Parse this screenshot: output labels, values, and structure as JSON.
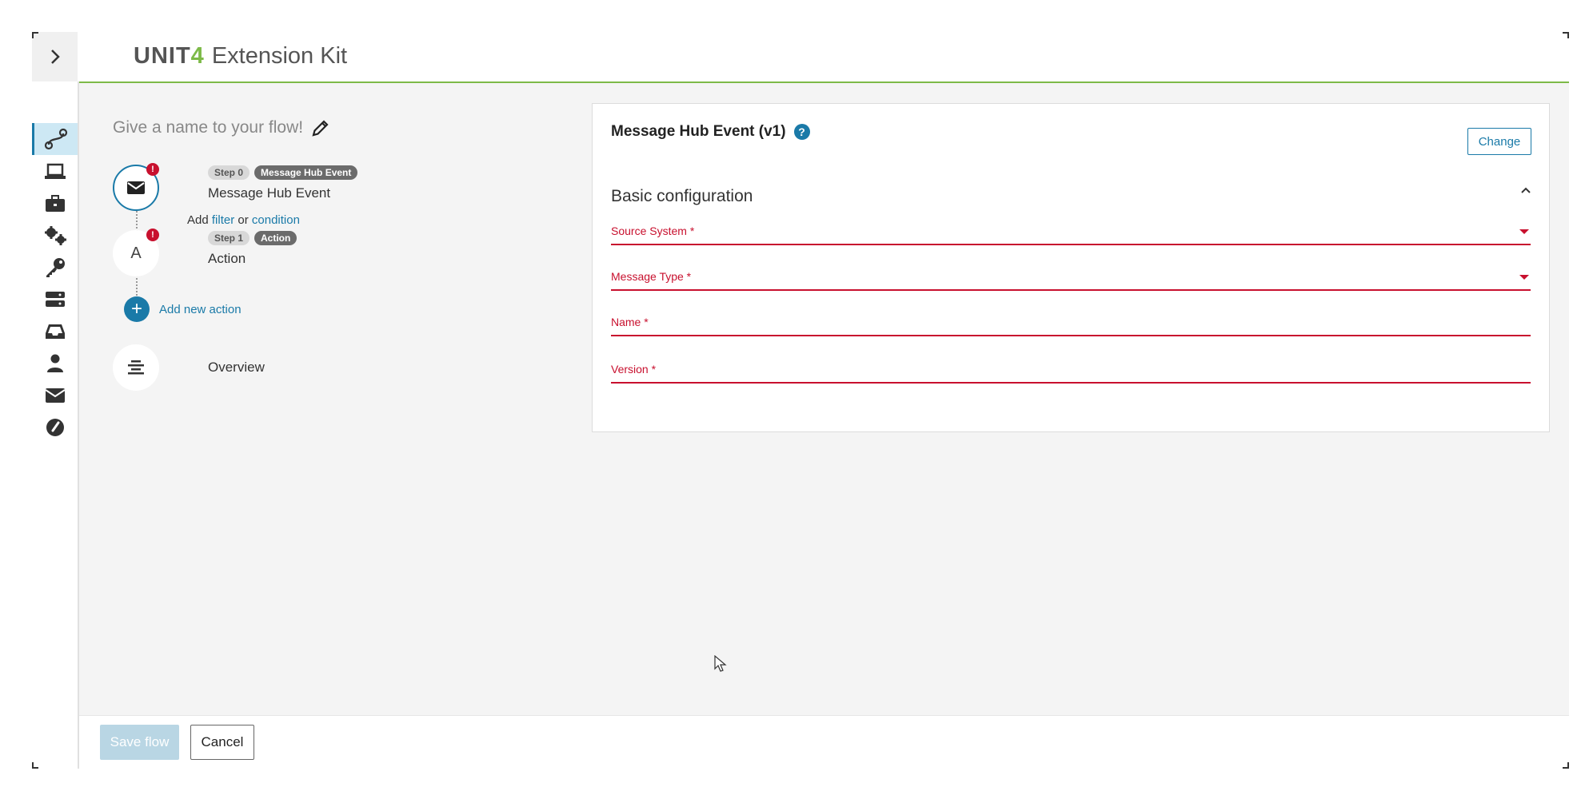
{
  "header": {
    "brand_unit": "UNIT",
    "brand_four": "4",
    "brand_product": "Extension Kit",
    "expand_icon": "chevron-right-icon"
  },
  "rail": {
    "items": [
      {
        "icon": "flows-icon",
        "active": true
      },
      {
        "icon": "laptop-icon"
      },
      {
        "icon": "briefcase-icon"
      },
      {
        "icon": "gears-icon"
      },
      {
        "icon": "key-icon"
      },
      {
        "icon": "servers-icon"
      },
      {
        "icon": "inbox-icon"
      },
      {
        "icon": "user-icon"
      },
      {
        "icon": "envelope-icon"
      },
      {
        "icon": "dashboard-icon"
      }
    ]
  },
  "flow": {
    "name_placeholder": "Give a name to your flow!",
    "steps": [
      {
        "step_chip": "Step 0",
        "type_chip": "Message Hub Event",
        "title": "Message Hub Event",
        "icon": "envelope-icon",
        "error": "!"
      },
      {
        "step_chip": "Step 1",
        "type_chip": "Action",
        "title": "Action",
        "icon_letter": "A",
        "error": "!"
      }
    ],
    "add_prefix": "Add",
    "add_filter": "filter",
    "add_or": "or",
    "add_condition": "condition",
    "add_new_action": "Add new action",
    "overview": "Overview"
  },
  "panel": {
    "title": "Message Hub Event (v1)",
    "help": "?",
    "change_label": "Change",
    "section_title": "Basic configuration",
    "fields": [
      {
        "label": "Source System *",
        "type": "select"
      },
      {
        "label": "Message Type *",
        "type": "select"
      },
      {
        "label": "Name *",
        "type": "text"
      },
      {
        "label": "Version *",
        "type": "text"
      }
    ],
    "error_color": "#c8102e"
  },
  "footer": {
    "save_label": "Save flow",
    "cancel_label": "Cancel"
  },
  "colors": {
    "accent": "#1a7aa8",
    "brand_green": "#7dba48",
    "error": "#c8102e"
  }
}
